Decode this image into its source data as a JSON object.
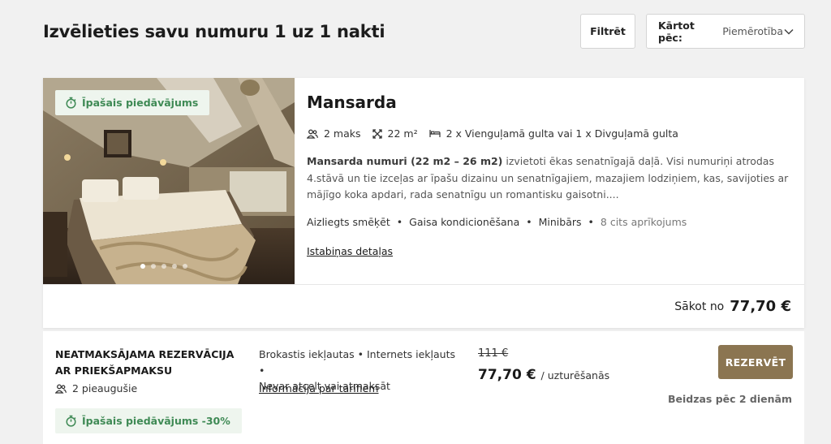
{
  "header": {
    "title": "Izvēlieties savu numuru 1 uz 1 nakti",
    "filter_label": "Filtrēt",
    "sort_label": "Kārtot pēc:",
    "sort_value": "Piemērotība"
  },
  "room": {
    "badge": "Īpašais piedāvājums",
    "name": "Mansarda",
    "specs": {
      "guests": "2 maks",
      "area": "22 m²",
      "beds": "2 x Vienguļamā gulta vai 1 x Divguļamā gulta"
    },
    "description_bold": "Mansarda numuri (22 m2 – 26 m2)",
    "description_rest": " izvietoti ēkas senatnīgajā daļā. Visi numuriņi atrodas 4.stāvā un tie izceļas ar īpašu dizainu un senatnīgajiem, mazajiem lodziņiem, kas, savijoties ar mājīgo koka apdari, rada senatnīgu un romantisku gaisotni....",
    "amenities": [
      "Aizliegts smēķēt",
      "Gaisa kondicionēšana",
      "Minibārs"
    ],
    "amenities_separator": "•",
    "amenities_more": "8 cits aprīkojums",
    "details_link": "Istabiņas detaļas",
    "price_prefix": "Sākot no",
    "price": "77,70 €",
    "gallery": {
      "total": 5,
      "active": 1
    }
  },
  "rate": {
    "title": "NEATMAKSĀJAMA REZERVĀCIJA AR PRIEKŠAPMAKSU",
    "guests": "2 pieaugušie",
    "badge": "Īpašais piedāvājums -30%",
    "inclusions_line1": "Brokastis iekļautas • Internets iekļauts •",
    "inclusions_line2": "Nevar atcelt vai atmaksāt",
    "tariff_link": "Informācija par tarifiem",
    "old_price": "111 €",
    "price": "77,70 €",
    "price_unit": "/ uzturēšanās",
    "reserve_label": "REZERVĒT",
    "expires": "Beidzas pēc 2 dienām"
  },
  "colors": {
    "accent_button": "#8b7551",
    "badge_bg": "#eef5ee",
    "badge_text": "#3f8a55"
  },
  "icons": {
    "badge": "stopwatch-icon",
    "guests": "people-icon",
    "area": "expand-arrows-icon",
    "beds": "bed-icon",
    "sort": "chevron-down-icon"
  }
}
